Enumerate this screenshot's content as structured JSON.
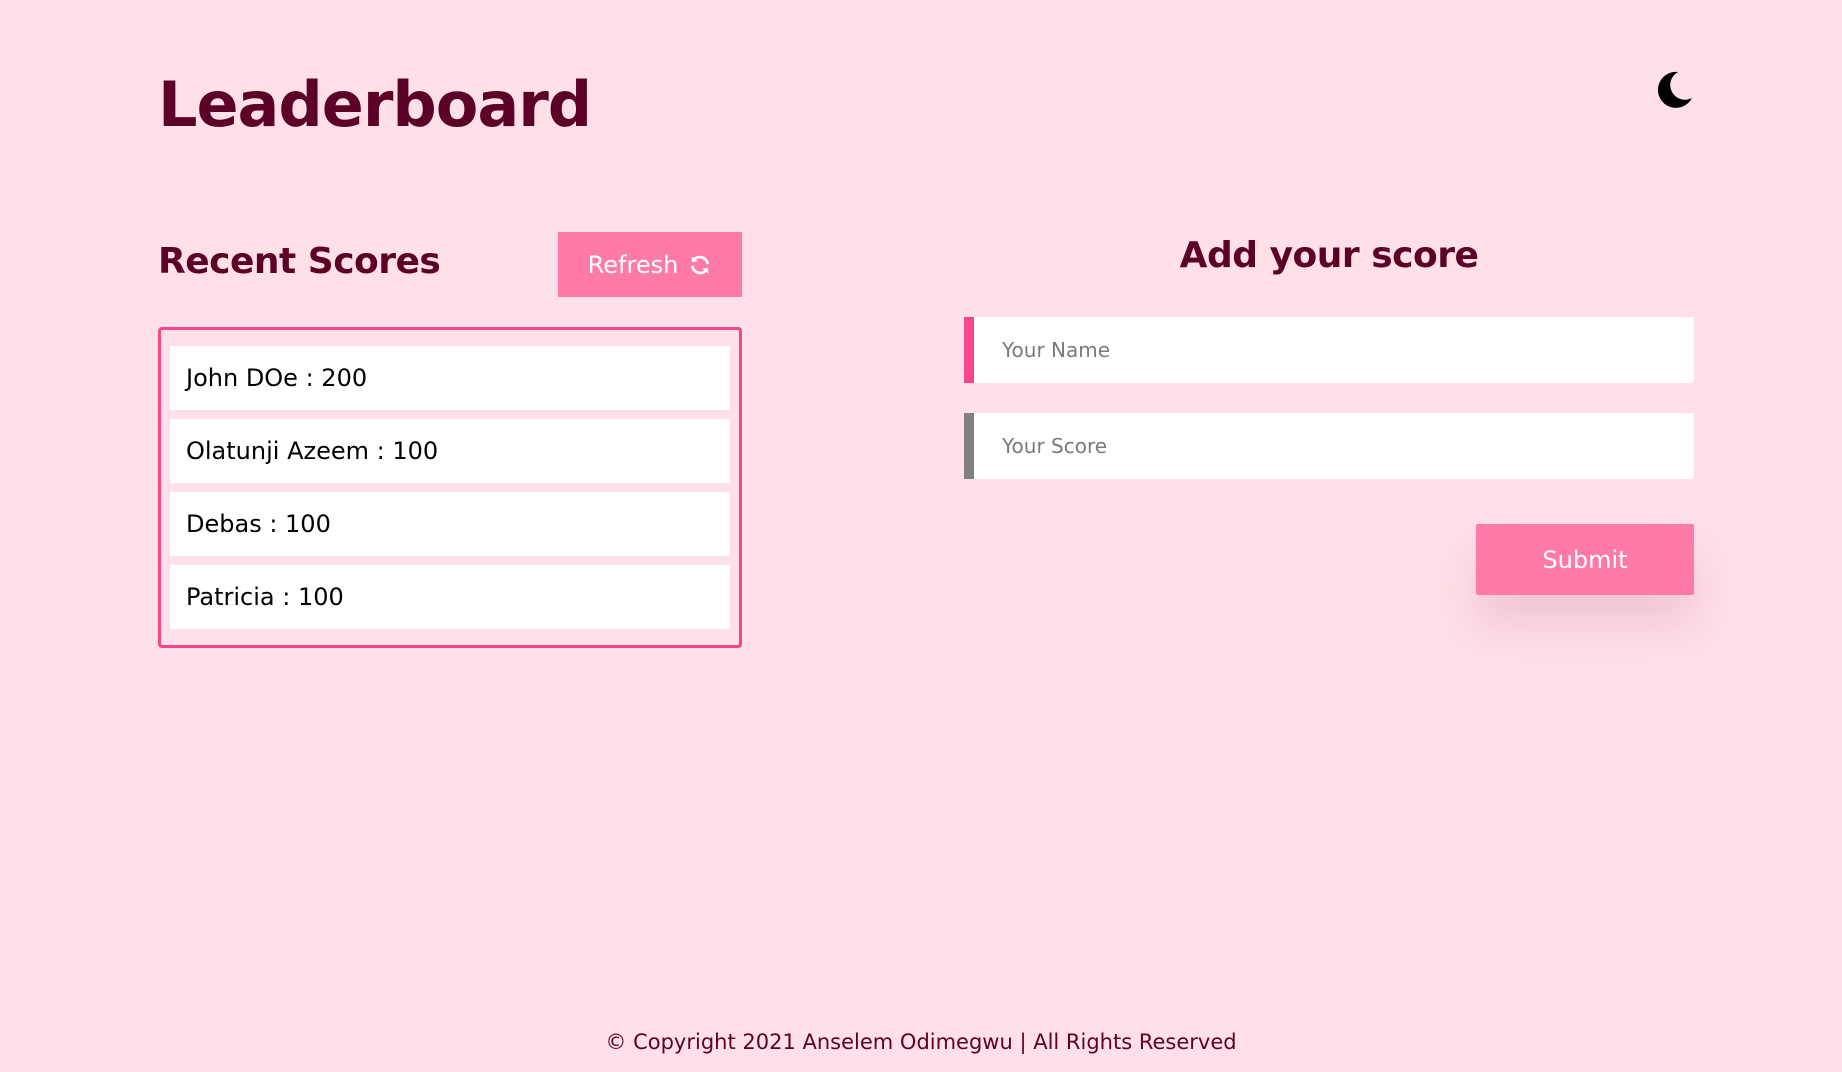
{
  "header": {
    "title": "Leaderboard",
    "theme_toggle_icon": "moon-icon"
  },
  "recent": {
    "heading": "Recent Scores",
    "refresh_label": "Refresh",
    "refresh_icon": "refresh-icon",
    "scores": [
      "John DOe : 200",
      "Olatunji Azeem : 100",
      "Debas : 100",
      "Patricia : 100"
    ]
  },
  "form": {
    "heading": "Add your score",
    "name_placeholder": "Your Name",
    "score_placeholder": "Your Score",
    "submit_label": "Submit"
  },
  "footer": {
    "text": "© Copyright 2021 Anselem Odimegwu | All Rights Reserved"
  },
  "colors": {
    "background": "#ffdfe8",
    "heading": "#5c0226",
    "button": "#ff7aa6",
    "accent_border": "#f7468a",
    "inactive_border": "#808080"
  }
}
